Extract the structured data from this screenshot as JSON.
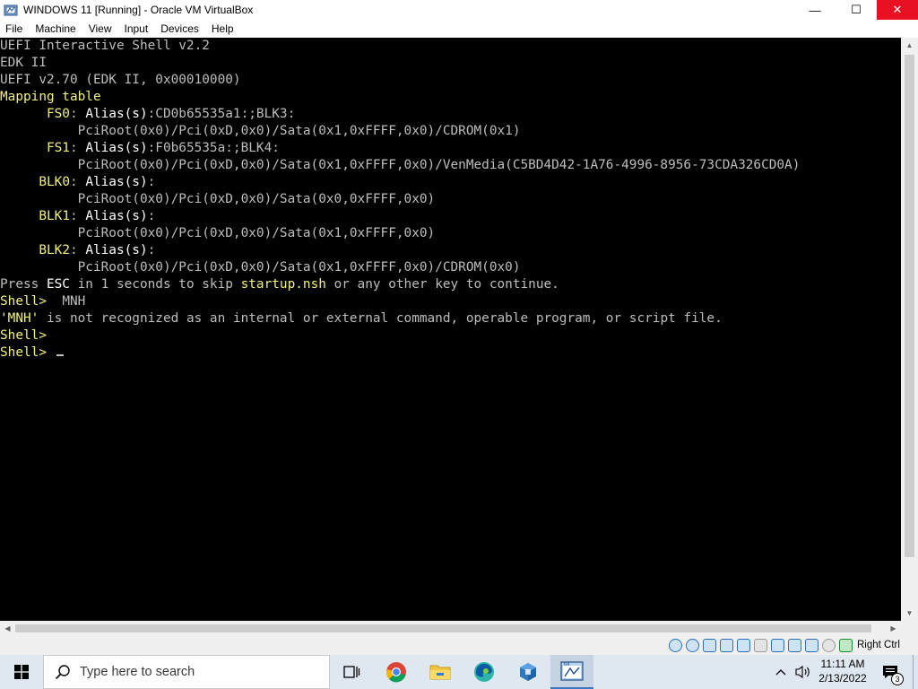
{
  "window": {
    "title": "WINDOWS 11 [Running] - Oracle VM VirtualBox",
    "icon": "virtualbox-icon",
    "controls": {
      "minimize": "—",
      "maximize": "☐",
      "close": "✕"
    }
  },
  "menu": {
    "items": [
      "File",
      "Machine",
      "View",
      "Input",
      "Devices",
      "Help"
    ]
  },
  "console": {
    "l1": "UEFI Interactive Shell v2.2",
    "l2": "EDK II",
    "l3": "UEFI v2.70 (EDK II, 0x00010000)",
    "l4": "Mapping table",
    "fs0_name": "FS0",
    "fs0_alias_label": "Alias(s)",
    "fs0_alias_value": ":CD0b65535a1:;BLK3:",
    "fs0_path": "PciRoot(0x0)/Pci(0xD,0x0)/Sata(0x1,0xFFFF,0x0)/CDROM(0x1)",
    "fs1_name": "FS1",
    "fs1_alias_label": "Alias(s)",
    "fs1_alias_value": ":F0b65535a:;BLK4:",
    "fs1_path": "PciRoot(0x0)/Pci(0xD,0x0)/Sata(0x1,0xFFFF,0x0)/VenMedia(C5BD4D42-1A76-4996-8956-73CDA326CD0A)",
    "blk0_name": "BLK0",
    "blk0_alias_label": "Alias(s)",
    "blk0_path": "PciRoot(0x0)/Pci(0xD,0x0)/Sata(0x0,0xFFFF,0x0)",
    "blk1_name": "BLK1",
    "blk1_alias_label": "Alias(s)",
    "blk1_path": "PciRoot(0x0)/Pci(0xD,0x0)/Sata(0x1,0xFFFF,0x0)",
    "blk2_name": "BLK2",
    "blk2_alias_label": "Alias(s)",
    "blk2_path": "PciRoot(0x0)/Pci(0xD,0x0)/Sata(0x1,0xFFFF,0x0)/CDROM(0x0)",
    "press_a": "Press ",
    "press_esc": "ESC",
    "press_b": " in 1 seconds to skip ",
    "press_nsh": "startup.nsh",
    "press_c": " or any other key to continue.",
    "prompt": "Shell>",
    "cmd1": "MNH",
    "err_name": "'MNH'",
    "err_rest": " is not recognized as an internal or external command, operable program, or script file."
  },
  "statusbar": {
    "host_key": "Right Ctrl"
  },
  "taskbar": {
    "search_placeholder": "Type here to search",
    "time": "11:11 AM",
    "date": "2/13/2022",
    "notifications_count": "3"
  },
  "colors": {
    "console_bg": "#000000",
    "console_text": "#bdbdbd",
    "console_highlight": "#f2f27a",
    "console_bright": "#ffffff",
    "close_button": "#e81123",
    "taskbar": "#dfe7f1"
  }
}
